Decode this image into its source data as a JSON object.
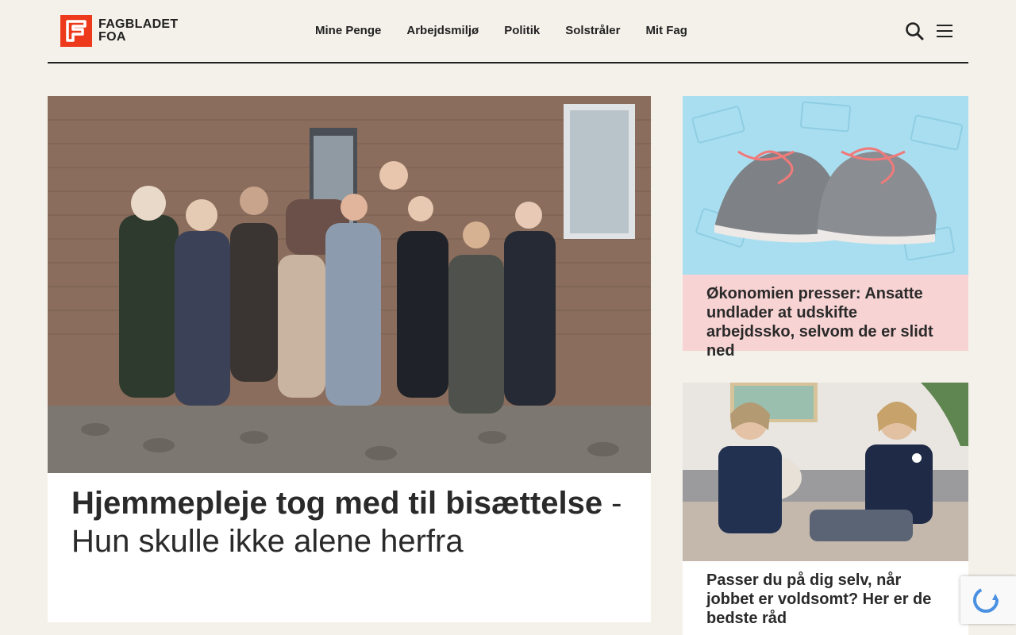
{
  "header": {
    "logo": {
      "line1": "FAGBLADET",
      "line2": "FOA",
      "color": "#ee3a1c"
    },
    "nav": [
      "Mine Penge",
      "Arbejdsmiljø",
      "Politik",
      "Solstråler",
      "Mit Fag"
    ],
    "search_icon": "search-icon",
    "menu_icon": "hamburger-menu-icon"
  },
  "hero": {
    "title_bold": "Hjemmepleje tog med til bisættelse",
    "title_rest": " - Hun skulle ikke alene herfra"
  },
  "cards": [
    {
      "title_bold": "Økonomien presser:",
      "title_rest": " Ansatte undlader at udskifte arbejdssko, selvom de er slidt ned",
      "background": "#f8d3d3"
    },
    {
      "title_bold": "Passer du på dig selv, når jobbet er voldsomt?",
      "title_rest": " Her er de bedste råd",
      "background": "#ffffff"
    }
  ]
}
